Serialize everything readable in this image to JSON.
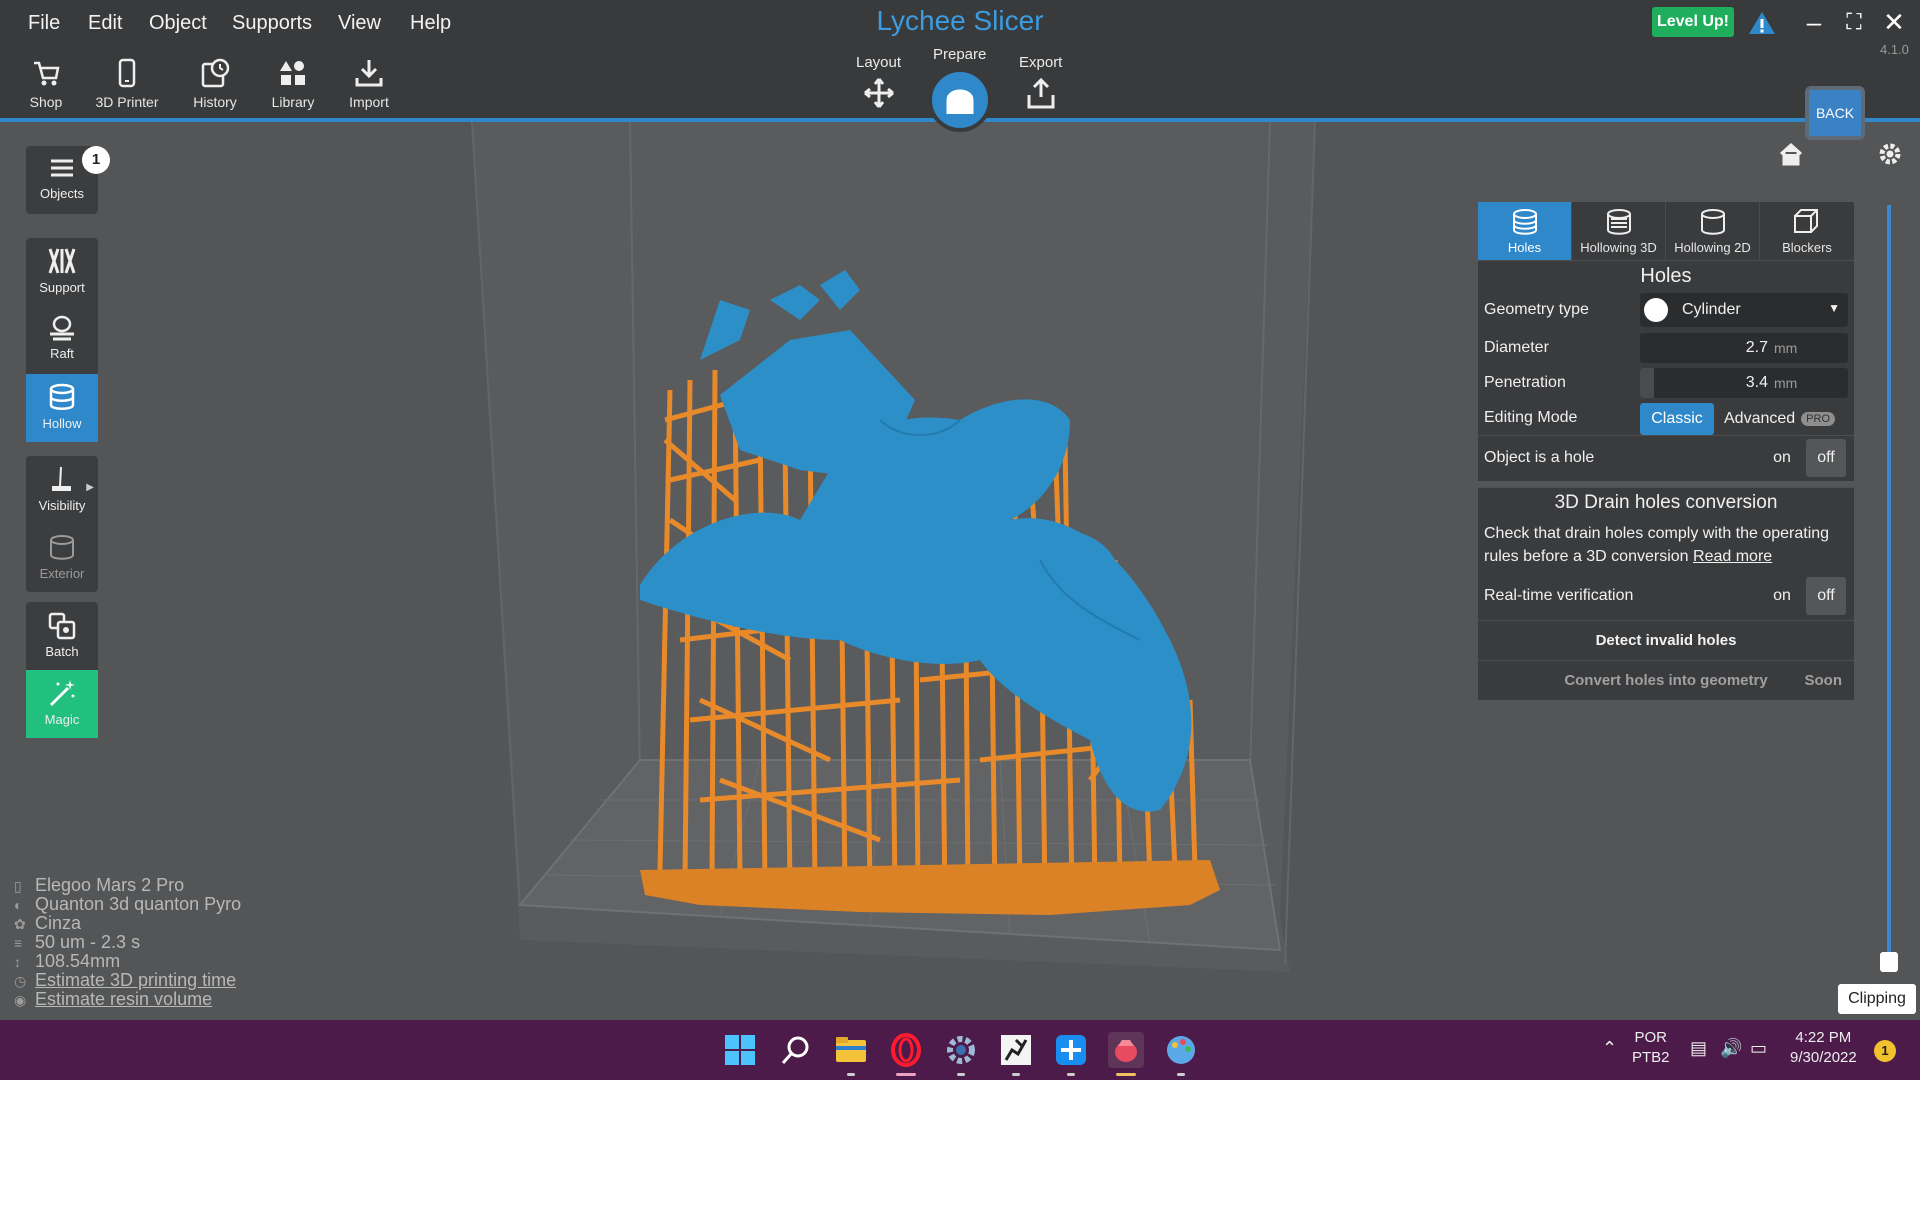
{
  "app": {
    "title": "Lychee Slicer",
    "version": "4.1.0",
    "level_up": "Level Up!",
    "back_label": "BACK"
  },
  "menu": [
    "File",
    "Edit",
    "Object",
    "Supports",
    "View",
    "Help"
  ],
  "toolbar": {
    "shop": "Shop",
    "printer": "3D Printer",
    "history": "History",
    "library": "Library",
    "import": "Import"
  },
  "modes": {
    "layout": "Layout",
    "prepare": "Prepare",
    "export": "Export",
    "active": "Prepare"
  },
  "sidebar": {
    "objects": "Objects",
    "objects_count": "1",
    "support": "Support",
    "raft": "Raft",
    "hollow": "Hollow",
    "visibility": "Visibility",
    "exterior": "Exterior",
    "batch": "Batch",
    "magic": "Magic"
  },
  "info": {
    "printer": "Elegoo Mars 2 Pro",
    "resin": "Quanton 3d quanton Pyro",
    "color": "Cinza",
    "layer": "50 um - 2.3 s",
    "height": "108.54mm",
    "estimate_time": "Estimate 3D printing time",
    "estimate_volume": "Estimate resin volume"
  },
  "panel": {
    "tabs": [
      "Holes",
      "Hollowing 3D",
      "Hollowing 2D",
      "Blockers"
    ],
    "active_tab": "Holes",
    "section_title": "Holes",
    "geometry_type_label": "Geometry type",
    "geometry_type_value": "Cylinder",
    "diameter_label": "Diameter",
    "diameter_value": "2.7",
    "penetration_label": "Penetration",
    "penetration_value": "3.4",
    "unit": "mm",
    "editing_mode_label": "Editing Mode",
    "editing_mode_classic": "Classic",
    "editing_mode_advanced": "Advanced",
    "pro_badge": "PRO",
    "object_hole_label": "Object is a hole",
    "on": "on",
    "off": "off",
    "drain_title": "3D Drain holes conversion",
    "drain_desc": "Check that drain holes comply with the operating rules before a 3D conversion",
    "read_more": "Read more",
    "realtime_label": "Real-time verification",
    "detect_button": "Detect invalid holes",
    "convert_button": "Convert holes into geometry",
    "soon": "Soon"
  },
  "clipping": {
    "label": "Clipping"
  },
  "taskbar": {
    "lang_1": "POR",
    "lang_2": "PTB2",
    "time": "4:22 PM",
    "date": "9/30/2022",
    "notifications": "1"
  },
  "colors": {
    "accent": "#2e88c9",
    "model": "#2c8fc8",
    "supports": "#e8892a",
    "magic": "#21c07f",
    "level_up": "#1fae5b",
    "taskbar": "#4d1b4a"
  }
}
